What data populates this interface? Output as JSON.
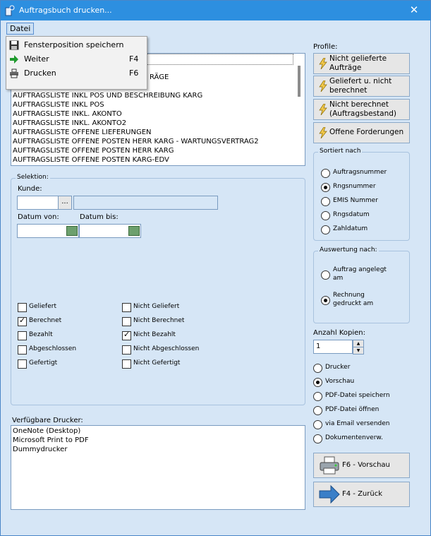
{
  "window": {
    "title": "Auftragsbuch drucken..."
  },
  "menu": {
    "label": "Datei",
    "items": [
      {
        "label": "Fensterposition speichern",
        "shortcut": ""
      },
      {
        "label": "Weiter",
        "shortcut": "F4"
      },
      {
        "label": "Drucken",
        "shortcut": "F6"
      }
    ]
  },
  "reports": {
    "partial_first": "RÄGE",
    "items": [
      "AUFTRAGSLISTE INKL POS UND BESCHREIBUNG KARG",
      "AUFTRAGSLISTE INKL POS",
      "AUFTRAGSLISTE INKL. AKONTO",
      "AUFTRAGSLISTE INKL. AKONTO2",
      "AUFTRAGSLISTE OFFENE LIEFERUNGEN",
      "AUFTRAGSLISTE OFFENE POSTEN HERR KARG - WARTUNGSVERTRAG2",
      "AUFTRAGSLISTE OFFENE POSTEN HERR KARG",
      "AUFTRAGSLISTE OFFENE POSTEN KARG-EDV"
    ]
  },
  "selection": {
    "group_label": "Selektion:",
    "kunde_label": "Kunde:",
    "kunde_value": "",
    "kunde_name": "",
    "browse_label": "...",
    "datum_von_label": "Datum von:",
    "datum_bis_label": "Datum bis:",
    "datum_von": "",
    "datum_bis": "",
    "checkboxes_left": [
      {
        "label": "Geliefert",
        "checked": false
      },
      {
        "label": "Berechnet",
        "checked": true
      },
      {
        "label": "Bezahlt",
        "checked": false
      },
      {
        "label": "Abgeschlossen",
        "checked": false
      },
      {
        "label": "Gefertigt",
        "checked": false
      }
    ],
    "checkboxes_right": [
      {
        "label": "Nicht Geliefert",
        "checked": false
      },
      {
        "label": "Nicht Berechnet",
        "checked": false
      },
      {
        "label": "Nicht Bezahlt",
        "checked": true
      },
      {
        "label": "Nicht Abgeschlossen",
        "checked": false
      },
      {
        "label": "Nicht Gefertigt",
        "checked": false
      }
    ],
    "check_mark": "✓"
  },
  "printers": {
    "label": "Verfügbare Drucker:",
    "items": [
      "OneNote (Desktop)",
      "Microsoft Print to PDF",
      "Dummydrucker"
    ]
  },
  "profiles": {
    "label": "Profile:",
    "buttons": [
      {
        "line1": "Nicht gelieferte",
        "line2": "Aufträge"
      },
      {
        "line1": "Geliefert u. nicht",
        "line2": "berechnet"
      },
      {
        "line1": "Nicht berechnet",
        "line2": "(Auftragsbestand)"
      },
      {
        "line1": "Offene Forderungen",
        "line2": ""
      }
    ]
  },
  "sort": {
    "label": "Sortiert nach",
    "options": [
      "Auftragsnummer",
      "Rngsnummer",
      "EMIS Nummer",
      "Rngsdatum",
      "Zahldatum"
    ],
    "selected": 1
  },
  "auswertung": {
    "label": "Auswertung nach:",
    "options": [
      {
        "line1": "Auftrag angelegt",
        "line2": "am"
      },
      {
        "line1": "Rechnung",
        "line2": "gedruckt am"
      }
    ],
    "selected": 1
  },
  "copies": {
    "label": "Anzahl Kopien:",
    "value": "1"
  },
  "output": {
    "options": [
      "Drucker",
      "Vorschau",
      "PDF-Datei speichern",
      "PDF-Datei öffnen",
      "via Email versenden",
      "Dokumentenverw."
    ],
    "selected": 1
  },
  "actions": {
    "preview": "F6 - Vorschau",
    "back": "F4 - Zurück"
  },
  "colors": {
    "titlebar": "#2d8fe0",
    "window_bg": "#d6e6f6",
    "accent_border": "#7a9bc0"
  }
}
